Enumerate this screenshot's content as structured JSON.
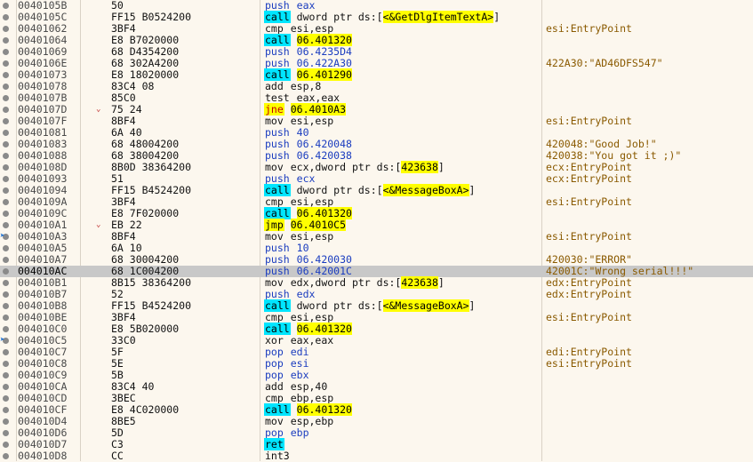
{
  "rows": [
    {
      "addr": "0040105B",
      "bytes": "50",
      "mn": "push",
      "cls": "push",
      "ops": [
        {
          "t": "eax",
          "k": "push"
        }
      ],
      "cmt": ""
    },
    {
      "addr": "0040105C",
      "bytes": "FF15 B0524200",
      "mn": "call",
      "cls": "call",
      "ops": [
        {
          "t": "dword ptr ds:[",
          "k": "reg"
        },
        {
          "t": "<&GetDlgItemTextA>",
          "k": "api"
        },
        {
          "t": "]",
          "k": "reg"
        }
      ],
      "cmt": ""
    },
    {
      "addr": "00401062",
      "bytes": "3BF4",
      "mn": "cmp",
      "cls": "plain",
      "ops": [
        {
          "t": "esi,esp",
          "k": "reg"
        }
      ],
      "cmt": "esi:EntryPoint"
    },
    {
      "addr": "00401064",
      "bytes": "E8 B7020000",
      "mn": "call",
      "cls": "call",
      "ops": [
        {
          "t": "06.401320",
          "k": "target"
        }
      ],
      "cmt": ""
    },
    {
      "addr": "00401069",
      "bytes": "68 D4354200",
      "mn": "push",
      "cls": "push",
      "ops": [
        {
          "t": "06.4235D4",
          "k": "push"
        }
      ],
      "cmt": ""
    },
    {
      "addr": "0040106E",
      "bytes": "68 302A4200",
      "mn": "push",
      "cls": "push",
      "ops": [
        {
          "t": "06.422A30",
          "k": "push"
        }
      ],
      "cmt": "422A30:\"AD46DFS547\""
    },
    {
      "addr": "00401073",
      "bytes": "E8 18020000",
      "mn": "call",
      "cls": "call",
      "ops": [
        {
          "t": "06.401290",
          "k": "target"
        }
      ],
      "cmt": ""
    },
    {
      "addr": "00401078",
      "bytes": "83C4 08",
      "mn": "add",
      "cls": "plain",
      "ops": [
        {
          "t": "esp,8",
          "k": "reg"
        }
      ],
      "cmt": ""
    },
    {
      "addr": "0040107B",
      "bytes": "85C0",
      "mn": "test",
      "cls": "plain",
      "ops": [
        {
          "t": "eax,eax",
          "k": "reg"
        }
      ],
      "cmt": ""
    },
    {
      "addr": "0040107D",
      "bytes": "75 24",
      "mn": "jne",
      "cls": "jcc",
      "ops": [
        {
          "t": "06.4010A3",
          "k": "target"
        }
      ],
      "cmt": "",
      "arrow": "v"
    },
    {
      "addr": "0040107F",
      "bytes": "8BF4",
      "mn": "mov",
      "cls": "plain",
      "ops": [
        {
          "t": "esi,esp",
          "k": "reg"
        }
      ],
      "cmt": "esi:EntryPoint"
    },
    {
      "addr": "00401081",
      "bytes": "6A 40",
      "mn": "push",
      "cls": "push",
      "ops": [
        {
          "t": "40",
          "k": "push"
        }
      ],
      "cmt": ""
    },
    {
      "addr": "00401083",
      "bytes": "68 48004200",
      "mn": "push",
      "cls": "push",
      "ops": [
        {
          "t": "06.420048",
          "k": "push"
        }
      ],
      "cmt": "420048:\"Good Job!\""
    },
    {
      "addr": "00401088",
      "bytes": "68 38004200",
      "mn": "push",
      "cls": "push",
      "ops": [
        {
          "t": "06.420038",
          "k": "push"
        }
      ],
      "cmt": "420038:\"You got it ;)\""
    },
    {
      "addr": "0040108D",
      "bytes": "8B0D 38364200",
      "mn": "mov",
      "cls": "plain",
      "ops": [
        {
          "t": "ecx,dword ptr ds:[",
          "k": "reg"
        },
        {
          "t": "423638",
          "k": "api"
        },
        {
          "t": "]",
          "k": "reg"
        }
      ],
      "cmt": "ecx:EntryPoint"
    },
    {
      "addr": "00401093",
      "bytes": "51",
      "mn": "push",
      "cls": "push",
      "ops": [
        {
          "t": "ecx",
          "k": "push"
        }
      ],
      "cmt": "ecx:EntryPoint"
    },
    {
      "addr": "00401094",
      "bytes": "FF15 B4524200",
      "mn": "call",
      "cls": "call",
      "ops": [
        {
          "t": "dword ptr ds:[",
          "k": "reg"
        },
        {
          "t": "<&MessageBoxA>",
          "k": "api"
        },
        {
          "t": "]",
          "k": "reg"
        }
      ],
      "cmt": ""
    },
    {
      "addr": "0040109A",
      "bytes": "3BF4",
      "mn": "cmp",
      "cls": "plain",
      "ops": [
        {
          "t": "esi,esp",
          "k": "reg"
        }
      ],
      "cmt": "esi:EntryPoint"
    },
    {
      "addr": "0040109C",
      "bytes": "E8 7F020000",
      "mn": "call",
      "cls": "call",
      "ops": [
        {
          "t": "06.401320",
          "k": "target"
        }
      ],
      "cmt": ""
    },
    {
      "addr": "004010A1",
      "bytes": "EB 22",
      "mn": "jmp",
      "cls": "jmp",
      "ops": [
        {
          "t": "06.4010C5",
          "k": "target"
        }
      ],
      "cmt": "",
      "arrow": "v"
    },
    {
      "addr": "004010A3",
      "bytes": "8BF4",
      "mn": "mov",
      "cls": "plain",
      "ops": [
        {
          "t": "esi,esp",
          "k": "reg"
        }
      ],
      "cmt": "esi:EntryPoint",
      "ext": ">"
    },
    {
      "addr": "004010A5",
      "bytes": "6A 10",
      "mn": "push",
      "cls": "push",
      "ops": [
        {
          "t": "10",
          "k": "push"
        }
      ],
      "cmt": ""
    },
    {
      "addr": "004010A7",
      "bytes": "68 30004200",
      "mn": "push",
      "cls": "push",
      "ops": [
        {
          "t": "06.420030",
          "k": "push"
        }
      ],
      "cmt": "420030:\"ERROR\""
    },
    {
      "addr": "004010AC",
      "bytes": "68 1C004200",
      "mn": "push",
      "cls": "push",
      "ops": [
        {
          "t": "06.42001C",
          "k": "push"
        }
      ],
      "cmt": "42001C:\"Wrong serial!!!\"",
      "selected": true
    },
    {
      "addr": "004010B1",
      "bytes": "8B15 38364200",
      "mn": "mov",
      "cls": "plain",
      "ops": [
        {
          "t": "edx,dword ptr ds:[",
          "k": "reg"
        },
        {
          "t": "423638",
          "k": "api"
        },
        {
          "t": "]",
          "k": "reg"
        }
      ],
      "cmt": "edx:EntryPoint"
    },
    {
      "addr": "004010B7",
      "bytes": "52",
      "mn": "push",
      "cls": "push",
      "ops": [
        {
          "t": "edx",
          "k": "push"
        }
      ],
      "cmt": "edx:EntryPoint"
    },
    {
      "addr": "004010B8",
      "bytes": "FF15 B4524200",
      "mn": "call",
      "cls": "call",
      "ops": [
        {
          "t": "dword ptr ds:[",
          "k": "reg"
        },
        {
          "t": "<&MessageBoxA>",
          "k": "api"
        },
        {
          "t": "]",
          "k": "reg"
        }
      ],
      "cmt": ""
    },
    {
      "addr": "004010BE",
      "bytes": "3BF4",
      "mn": "cmp",
      "cls": "plain",
      "ops": [
        {
          "t": "esi,esp",
          "k": "reg"
        }
      ],
      "cmt": "esi:EntryPoint"
    },
    {
      "addr": "004010C0",
      "bytes": "E8 5B020000",
      "mn": "call",
      "cls": "call",
      "ops": [
        {
          "t": "06.401320",
          "k": "target"
        }
      ],
      "cmt": ""
    },
    {
      "addr": "004010C5",
      "bytes": "33C0",
      "mn": "xor",
      "cls": "plain",
      "ops": [
        {
          "t": "eax,eax",
          "k": "reg"
        }
      ],
      "cmt": "",
      "ext": ">"
    },
    {
      "addr": "004010C7",
      "bytes": "5F",
      "mn": "pop",
      "cls": "pop",
      "ops": [
        {
          "t": "edi",
          "k": "push"
        }
      ],
      "cmt": "edi:EntryPoint"
    },
    {
      "addr": "004010C8",
      "bytes": "5E",
      "mn": "pop",
      "cls": "pop",
      "ops": [
        {
          "t": "esi",
          "k": "push"
        }
      ],
      "cmt": "esi:EntryPoint"
    },
    {
      "addr": "004010C9",
      "bytes": "5B",
      "mn": "pop",
      "cls": "pop",
      "ops": [
        {
          "t": "ebx",
          "k": "push"
        }
      ],
      "cmt": ""
    },
    {
      "addr": "004010CA",
      "bytes": "83C4 40",
      "mn": "add",
      "cls": "plain",
      "ops": [
        {
          "t": "esp,40",
          "k": "reg"
        }
      ],
      "cmt": ""
    },
    {
      "addr": "004010CD",
      "bytes": "3BEC",
      "mn": "cmp",
      "cls": "plain",
      "ops": [
        {
          "t": "ebp,esp",
          "k": "reg"
        }
      ],
      "cmt": ""
    },
    {
      "addr": "004010CF",
      "bytes": "E8 4C020000",
      "mn": "call",
      "cls": "call",
      "ops": [
        {
          "t": "06.401320",
          "k": "target"
        }
      ],
      "cmt": ""
    },
    {
      "addr": "004010D4",
      "bytes": "8BE5",
      "mn": "mov",
      "cls": "plain",
      "ops": [
        {
          "t": "esp,ebp",
          "k": "reg"
        }
      ],
      "cmt": ""
    },
    {
      "addr": "004010D6",
      "bytes": "5D",
      "mn": "pop",
      "cls": "pop",
      "ops": [
        {
          "t": "ebp",
          "k": "push"
        }
      ],
      "cmt": ""
    },
    {
      "addr": "004010D7",
      "bytes": "C3",
      "mn": "ret",
      "cls": "ret",
      "ops": [],
      "cmt": ""
    },
    {
      "addr": "004010D8",
      "bytes": "CC",
      "mn": "int3",
      "cls": "int3",
      "ops": [],
      "cmt": ""
    }
  ]
}
